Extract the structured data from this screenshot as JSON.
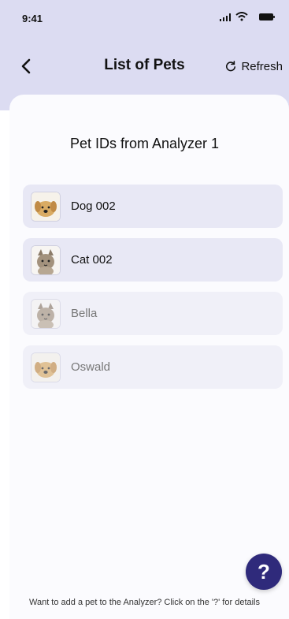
{
  "status_bar": {
    "time": "9:41"
  },
  "header": {
    "title": "List of Pets",
    "refresh_label": "Refresh"
  },
  "content": {
    "section_title": "Pet IDs from Analyzer 1",
    "pets": [
      {
        "name": "Dog 002",
        "type": "dog",
        "state": "active"
      },
      {
        "name": "Cat 002",
        "type": "cat",
        "state": "active"
      },
      {
        "name": "Bella",
        "type": "cat",
        "state": "inactive"
      },
      {
        "name": "Oswald",
        "type": "dog",
        "state": "inactive"
      }
    ]
  },
  "help": {
    "fab_label": "?",
    "hint": "Want to add a pet to the Analyzer? Click on the '?' for details"
  },
  "colors": {
    "header_bg": "#dcdcf2",
    "card_active": "#e8e8f5",
    "card_inactive": "#f0f0f8",
    "fab_bg": "#2f2a7b"
  }
}
